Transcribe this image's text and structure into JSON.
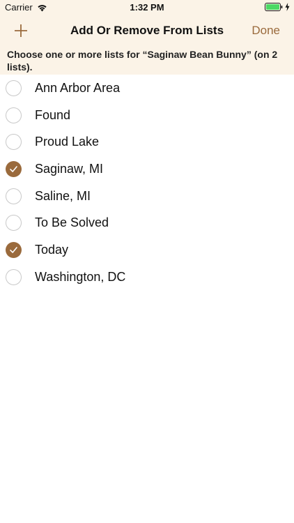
{
  "status_bar": {
    "carrier": "Carrier",
    "time": "1:32 PM"
  },
  "nav": {
    "title": "Add Or Remove From Lists",
    "done_label": "Done"
  },
  "instruction": "Choose one or more lists for “Saginaw Bean Bunny” (on 2 lists).",
  "colors": {
    "accent": "#9a6a3c",
    "header_bg": "#fbf3e7",
    "battery": "#4cd964"
  },
  "lists": [
    {
      "label": "Ann Arbor Area",
      "checked": false
    },
    {
      "label": "Found",
      "checked": false
    },
    {
      "label": "Proud Lake",
      "checked": false
    },
    {
      "label": "Saginaw, MI",
      "checked": true
    },
    {
      "label": "Saline, MI",
      "checked": false
    },
    {
      "label": "To Be Solved",
      "checked": false
    },
    {
      "label": "Today",
      "checked": true
    },
    {
      "label": "Washington, DC",
      "checked": false
    }
  ]
}
